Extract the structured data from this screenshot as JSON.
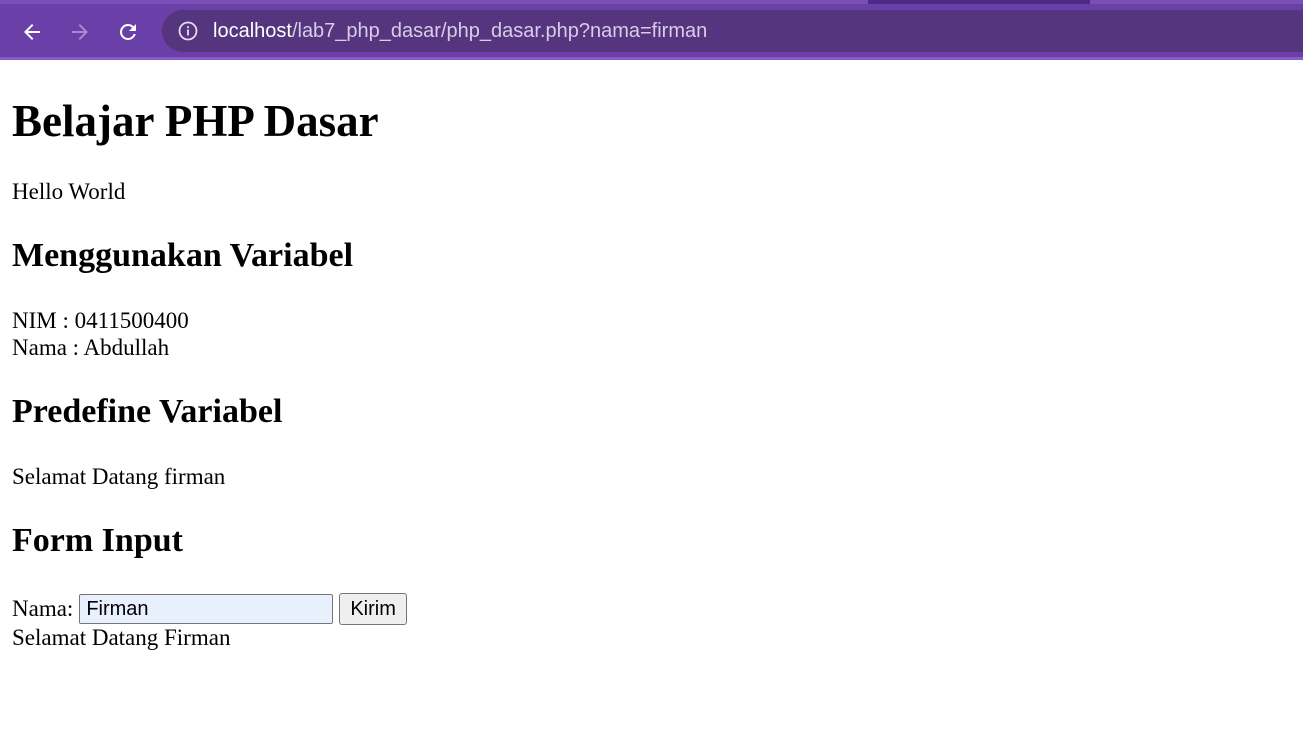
{
  "browser": {
    "url_host": "localhost",
    "url_path": "/lab7_php_dasar/php_dasar.php?nama=firman"
  },
  "page": {
    "title": "Belajar PHP Dasar",
    "hello": "Hello World",
    "section_variabel": "Menggunakan Variabel",
    "nim_line": "NIM : 0411500400",
    "nama_line": "Nama : Abdullah",
    "section_predefine": "Predefine Variabel",
    "welcome_get": "Selamat Datang firman",
    "section_form": "Form Input",
    "form": {
      "label": "Nama:",
      "input_value": "Firman",
      "submit_label": "Kirim"
    },
    "welcome_post": "Selamat Datang Firman"
  }
}
